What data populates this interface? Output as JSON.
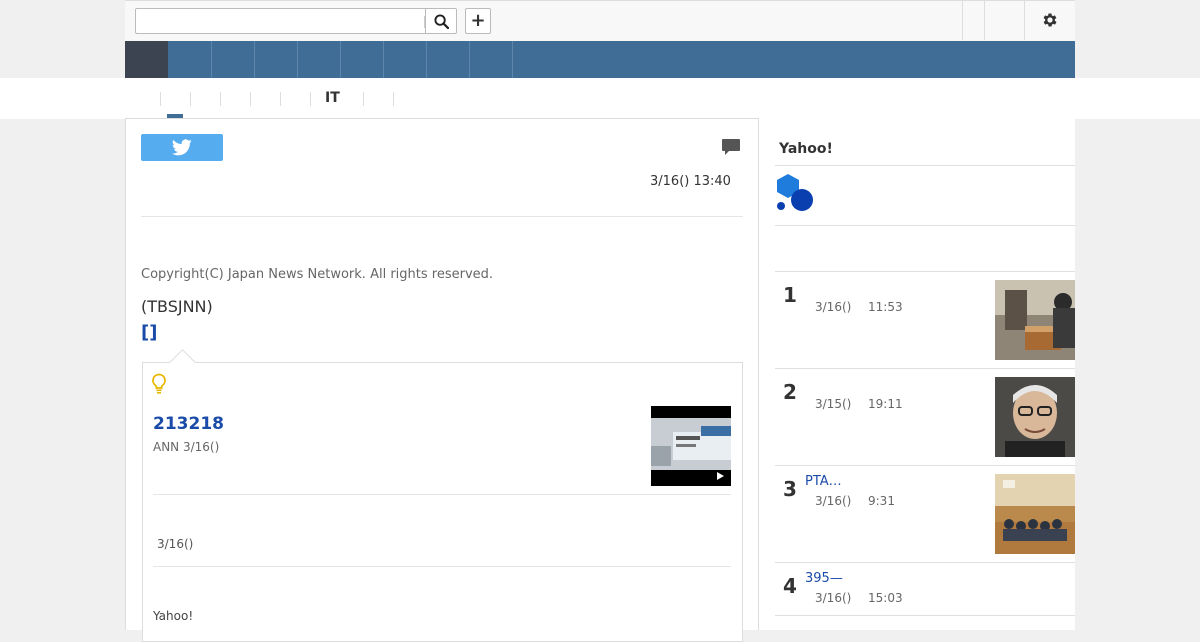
{
  "header": {
    "search_placeholder": "",
    "search_icon": "search-icon",
    "add_icon": "plus-icon",
    "settings_icon": "gear-icon",
    "add_label": "+"
  },
  "subnav": {
    "it_label": "IT"
  },
  "article": {
    "datetime": "3/16() 13:40",
    "copyright": "Copyright(C) Japan News Network. All rights reserved.",
    "source": "(TBSJNN)",
    "bracket_link": "[]",
    "share_icon": "twitter-icon",
    "comment_icon": "comment-icon"
  },
  "related": {
    "icon": "lightbulb-icon",
    "title": "213218",
    "meta": "ANN 3/16()",
    "date": "3/16()",
    "footer": "Yahoo!"
  },
  "sidebar": {
    "title": "Yahoo!",
    "ranking": [
      {
        "rank": "1",
        "title": "",
        "date": "3/16()",
        "time": "11:53"
      },
      {
        "rank": "2",
        "title": "",
        "date": "3/15()",
        "time": "19:11"
      },
      {
        "rank": "3",
        "title": "PTA…",
        "date": "3/16()",
        "time": "9:31"
      },
      {
        "rank": "4",
        "title": "395—",
        "date": "3/16()",
        "time": "15:03"
      }
    ]
  },
  "colors": {
    "nav_blue": "#3f6d96",
    "nav_home": "#3c4452",
    "link_blue": "#1a4ba8",
    "twitter": "#55acee"
  }
}
